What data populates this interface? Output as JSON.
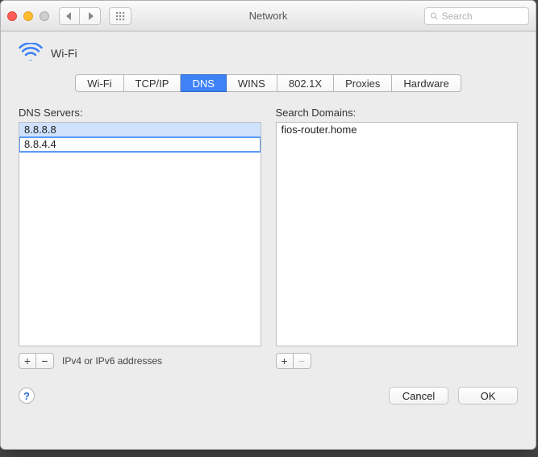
{
  "window": {
    "title": "Network",
    "search_placeholder": "Search"
  },
  "header": {
    "interface_label": "Wi‑Fi"
  },
  "tabs": [
    {
      "label": "Wi‑Fi",
      "active": false
    },
    {
      "label": "TCP/IP",
      "active": false
    },
    {
      "label": "DNS",
      "active": true
    },
    {
      "label": "WINS",
      "active": false
    },
    {
      "label": "802.1X",
      "active": false
    },
    {
      "label": "Proxies",
      "active": false
    },
    {
      "label": "Hardware",
      "active": false
    }
  ],
  "dns": {
    "label": "DNS Servers:",
    "servers": [
      "8.8.8.8",
      "8.8.4.4"
    ],
    "selected_index": 0,
    "editing_index": 1,
    "hint": "IPv4 or IPv6 addresses",
    "add_label": "+",
    "remove_label": "−"
  },
  "search_domains": {
    "label": "Search Domains:",
    "domains": [
      "fios-router.home"
    ],
    "add_label": "+",
    "remove_label": "−",
    "remove_enabled": false
  },
  "footer": {
    "help_label": "?",
    "cancel_label": "Cancel",
    "ok_label": "OK"
  }
}
